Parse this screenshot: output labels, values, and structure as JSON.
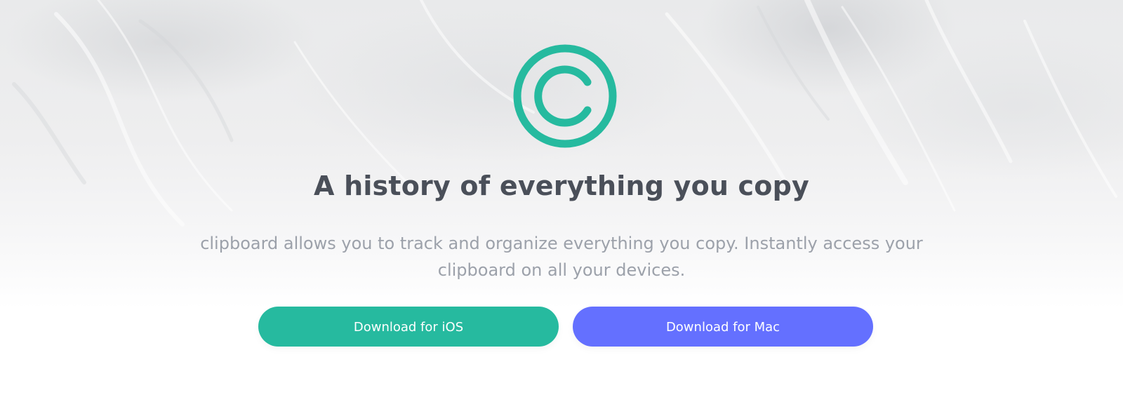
{
  "logo": {
    "icon": "copyright-circle-icon",
    "color": "#26ba9f"
  },
  "hero": {
    "headline": "A history of everything you copy",
    "subtext_line1": "clipboard allows you to track and organize everything you copy. Instantly access your",
    "subtext_line2": "clipboard on all your devices."
  },
  "buttons": {
    "ios": {
      "label": "Download for iOS",
      "color": "#26ba9f"
    },
    "mac": {
      "label": "Download for Mac",
      "color": "#6470ff"
    }
  },
  "colors": {
    "headline": "#4a4f59",
    "subtext": "#9ca1aa"
  }
}
